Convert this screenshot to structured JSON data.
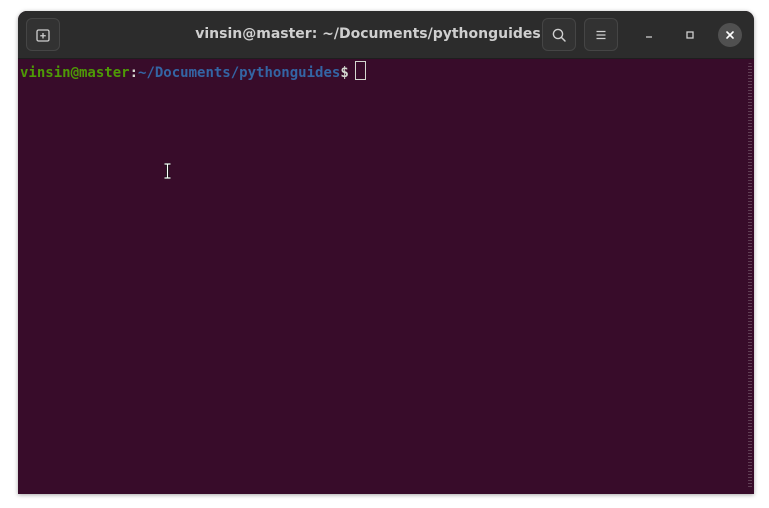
{
  "window": {
    "title": "vinsin@master: ~/Documents/pythonguides",
    "colors": {
      "terminal_bg": "#380c2a",
      "titlebar_bg": "#2c2c2c",
      "prompt_user": "#4e9a06",
      "prompt_path": "#3465a4",
      "text": "#d3d7cf"
    }
  },
  "toolbar": {
    "new_tab_icon": "new-tab-icon",
    "search_icon": "search-icon",
    "menu_icon": "hamburger-menu-icon"
  },
  "controls": {
    "minimize_icon": "minimize-icon",
    "maximize_icon": "maximize-icon",
    "close_icon": "close-icon"
  },
  "terminal": {
    "prompt_user_host": "vinsin@master",
    "prompt_colon": ":",
    "prompt_path": "~/Documents/pythonguides",
    "prompt_symbol": "$"
  }
}
